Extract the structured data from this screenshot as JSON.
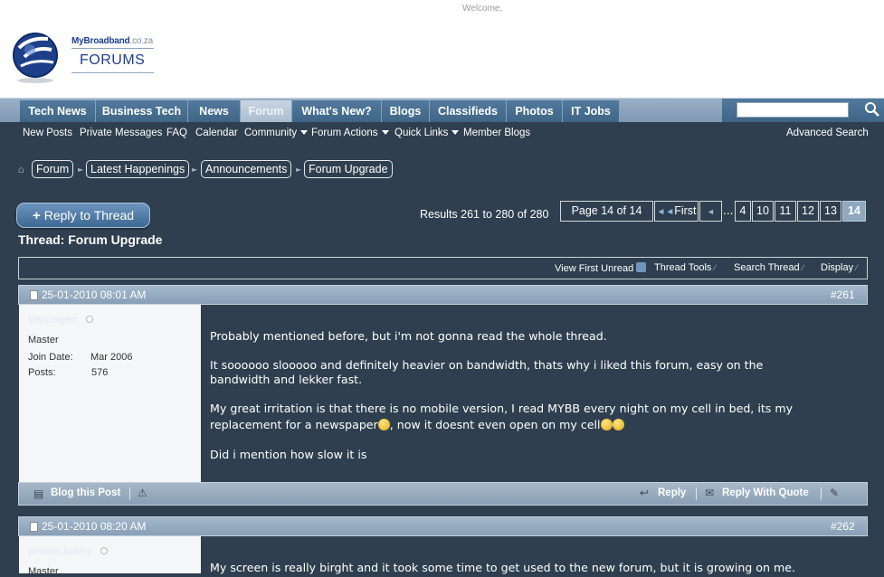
{
  "header": {
    "welcome": "Welcome,",
    "brand": "MyBroadband",
    "brand_suffix": ".co.za",
    "forums_logo": "FORUMS"
  },
  "nav": {
    "tabs": [
      "Tech News",
      "Business Tech",
      "News",
      "Forum",
      "What's New?",
      "Blogs",
      "Classifieds",
      "Photos",
      "IT Jobs"
    ],
    "active_tab": "Forum",
    "search_placeholder": ""
  },
  "subnav": {
    "items": [
      "New Posts",
      "Private Messages",
      "FAQ",
      "Calendar",
      "Community",
      "Forum Actions",
      "Quick Links",
      "Member Blogs"
    ],
    "dropdown_items": [
      "Community",
      "Forum Actions",
      "Quick Links"
    ],
    "advanced_search": "Advanced Search"
  },
  "breadcrumb": [
    "Forum",
    "Latest Happenings",
    "Announcements",
    "Forum Upgrade"
  ],
  "reply_button": {
    "plus": "+",
    "label": "Reply to Thread"
  },
  "results_text": "Results 261 to 280 of 280",
  "pagination": {
    "page_label": "Page 14 of 14",
    "first_label": "First",
    "ellipsis": "...",
    "pages": [
      "4",
      "10",
      "11",
      "12",
      "13",
      "14"
    ],
    "current_page": "14"
  },
  "thread_title": "Thread: Forum Upgrade",
  "thread_tools": [
    "View First Unread",
    "Thread Tools",
    "Search Thread",
    "Display"
  ],
  "posts": [
    {
      "date": "25-01-2010 08:01 AM",
      "number": "#261",
      "username": "Vercogen",
      "user_title": "Master",
      "join_label": "Join Date:",
      "join_date": "Mar 2006",
      "posts_label": "Posts:",
      "posts_count": "576",
      "paragraphs": [
        "Probably mentioned before, but i'm not gonna read the whole thread.",
        "It soooooo slooooo and definitely heavier on bandwidth, thats why i liked this forum, easy on the",
        "bandwidth and lekker fast.",
        "My great irritation is that there is no mobile version, I read MYBB every night on my cell in bed, its my",
        "replacement for a newspaper",
        ", now it doesnt even open on my cell",
        "Did i mention how slow it is"
      ],
      "footer": {
        "blog": "Blog this Post",
        "reply": "Reply",
        "quote": "Reply With Quote"
      }
    },
    {
      "date": "25-01-2010 08:20 AM",
      "number": "#262",
      "username": "phoneJunky",
      "user_title": "Master",
      "paragraphs": [
        "My screen is really birght and it took some time to get used to the new forum, but it is growing on me."
      ]
    }
  ],
  "colors": {
    "page_bg": "#2f3f4f",
    "nav_tab": "#46698b",
    "post_header": "#97acc2",
    "userinfo_bg": "#f4f6f8"
  }
}
